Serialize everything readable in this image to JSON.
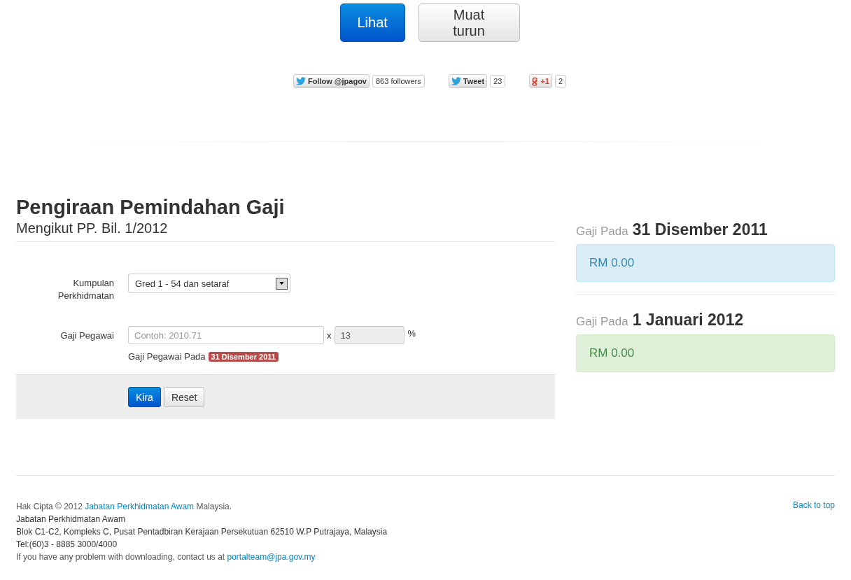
{
  "top_buttons": [
    {
      "label": "Lihat",
      "kind": "primary"
    },
    {
      "label": "Muat turun",
      "kind": "default"
    }
  ],
  "social": [
    {
      "kind": "twitter",
      "label": "Follow @jpagov",
      "count": "863 followers"
    },
    {
      "kind": "twitter",
      "label": "Tweet",
      "count": "23"
    },
    {
      "kind": "gplus",
      "label": "+1",
      "count": "2"
    }
  ],
  "title": "Pengiraan Pemindahan Gaji",
  "subtitle": "Mengikut PP. Bil. 1/2012",
  "form": {
    "group_label": "Kumpulan Perkhidmatan",
    "group_value": "Gred 1 - 54 dan setaraf",
    "salary_label": "Gaji Pegawai",
    "salary_placeholder": "Contoh: 2010.71",
    "times": "x",
    "percent_value": "13",
    "percent_sign": "%",
    "help_text": "Gaji Pegawai Pada",
    "help_badge": "31 Disember 2011",
    "buttons": [
      {
        "label": "Kira",
        "kind": "primary"
      },
      {
        "label": "Reset",
        "kind": "default"
      }
    ]
  },
  "results": [
    {
      "label": "Gaji Pada",
      "date": "31 Disember 2011",
      "amount": "RM 0.00",
      "kind": "info"
    },
    {
      "label": "Gaji Pada",
      "date": "1 Januari 2012",
      "amount": "RM 0.00",
      "kind": "success"
    }
  ],
  "footer": {
    "copyright_prefix": "Hak Cipta © 2012",
    "copyright_link": "Jabatan Perkhidmatan Awam",
    "copyright_suffix": "Malaysia.",
    "lines": [
      "Jabatan Perkhidmatan Awam",
      "Blok C1-C2, Kompleks C, Pusat Pentadbiran Kerajaan Persekutuan 62510 W.P Putrajaya, Malaysia",
      "Tel:(60)3 - 8885 3000/4000"
    ],
    "contact_prefix": "If you have any problem with downloading, contact us at",
    "contact_link": "portalteam@jpa.gov.my",
    "back_to_top": "Back to top"
  }
}
